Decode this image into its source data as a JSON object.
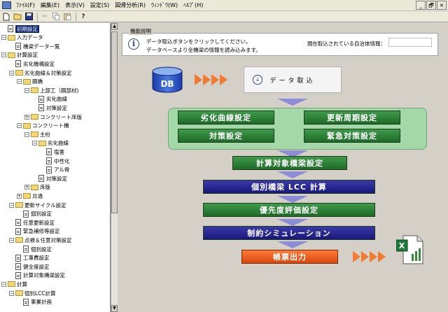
{
  "menubar": {
    "items": [
      "ﾌｧｲﾙ(F)",
      "編集(E)",
      "表示(V)",
      "設定(S)",
      "図帰分析(R)",
      "ｳｨﾝﾄﾞｳ(W)",
      "ﾍﾙﾌﾟ(H)"
    ],
    "window_controls": [
      "_",
      "🗗",
      "×"
    ]
  },
  "toolbar": {
    "icons": [
      "new-file-icon",
      "open-folder-icon",
      "save-icon",
      "cut-icon",
      "copy-icon",
      "paste-icon",
      "help-icon"
    ]
  },
  "tree": {
    "items": [
      {
        "label": "初期設定",
        "level": 0,
        "kind": "doc",
        "expander": "",
        "selected": true
      },
      {
        "label": "入力データ",
        "level": 0,
        "kind": "folder",
        "expander": "−"
      },
      {
        "label": "橋梁データ一覧",
        "level": 1,
        "kind": "doc",
        "expander": ""
      },
      {
        "label": "計算設定",
        "level": 0,
        "kind": "folder",
        "expander": "−"
      },
      {
        "label": "劣化機構設定",
        "level": 1,
        "kind": "doc",
        "expander": ""
      },
      {
        "label": "劣化曲線＆対策設定",
        "level": 1,
        "kind": "folder",
        "expander": "−"
      },
      {
        "label": "鋼橋",
        "level": 2,
        "kind": "folder",
        "expander": "−"
      },
      {
        "label": "上部工（鋼部材)",
        "level": 3,
        "kind": "folder",
        "expander": "−"
      },
      {
        "label": "劣化曲線",
        "level": 4,
        "kind": "doc",
        "expander": ""
      },
      {
        "label": "対策設定",
        "level": 4,
        "kind": "doc",
        "expander": ""
      },
      {
        "label": "コンクリート床版",
        "level": 3,
        "kind": "folder",
        "expander": "+"
      },
      {
        "label": "コンクリート橋",
        "level": 2,
        "kind": "folder",
        "expander": "−"
      },
      {
        "label": "主桁",
        "level": 3,
        "kind": "folder",
        "expander": "−"
      },
      {
        "label": "劣化曲線",
        "level": 4,
        "kind": "folder",
        "expander": "−"
      },
      {
        "label": "塩害",
        "level": 5,
        "kind": "doc",
        "expander": ""
      },
      {
        "label": "中性化",
        "level": 5,
        "kind": "doc",
        "expander": ""
      },
      {
        "label": "アル骨",
        "level": 5,
        "kind": "doc",
        "expander": ""
      },
      {
        "label": "対策設定",
        "level": 4,
        "kind": "doc",
        "expander": ""
      },
      {
        "label": "床版",
        "level": 3,
        "kind": "folder",
        "expander": "+"
      },
      {
        "label": "共通",
        "level": 2,
        "kind": "folder",
        "expander": "+"
      },
      {
        "label": "更新サイクル設定",
        "level": 1,
        "kind": "folder",
        "expander": "−"
      },
      {
        "label": "個別設定",
        "level": 2,
        "kind": "doc",
        "expander": ""
      },
      {
        "label": "任意更新設定",
        "level": 1,
        "kind": "doc",
        "expander": ""
      },
      {
        "label": "緊急補修等設定",
        "level": 1,
        "kind": "doc",
        "expander": ""
      },
      {
        "label": "点検＆任意対策設定",
        "level": 1,
        "kind": "folder",
        "expander": "−"
      },
      {
        "label": "個別設定",
        "level": 2,
        "kind": "doc",
        "expander": ""
      },
      {
        "label": "工事費設定",
        "level": 1,
        "kind": "doc",
        "expander": ""
      },
      {
        "label": "健全度設定",
        "level": 1,
        "kind": "doc",
        "expander": ""
      },
      {
        "label": "計算対象橋梁設定",
        "level": 1,
        "kind": "doc",
        "expander": ""
      },
      {
        "label": "計算",
        "level": 0,
        "kind": "folder",
        "expander": "−"
      },
      {
        "label": "個別LCC計算",
        "level": 1,
        "kind": "folder",
        "expander": "−"
      },
      {
        "label": "事業計画",
        "level": 2,
        "kind": "doc",
        "expander": ""
      }
    ]
  },
  "main": {
    "group_caption": "機能説明",
    "info_icon": "info-icon",
    "info_lines": [
      "データ取込ボタンをクリックしてください。",
      "データベースより全橋梁の情報を読み込みます。"
    ],
    "municipality_label": "現在取込されている自治体情報：",
    "municipality_value": "",
    "db_label": "DB",
    "data_import_label": "データ取込",
    "green_buttons": [
      "劣化曲線設定",
      "更新周期設定",
      "対策設定",
      "緊急対策設定"
    ],
    "flow_steps": [
      {
        "label": "計算対象橋梁設定",
        "style": "g"
      },
      {
        "label": "個別橋梁 LCC 計算",
        "style": "b"
      },
      {
        "label": "優先度評価設定",
        "style": "g"
      },
      {
        "label": "制約シミュレーション",
        "style": "b"
      },
      {
        "label": "帳票出力",
        "style": "o"
      }
    ],
    "colors": {
      "green": "#2f8a3a",
      "navy": "#22228c",
      "orange": "#f06020",
      "arrow": "#f07a30",
      "connector": "#8c8cd8",
      "panel": "#a5d8a8"
    }
  }
}
